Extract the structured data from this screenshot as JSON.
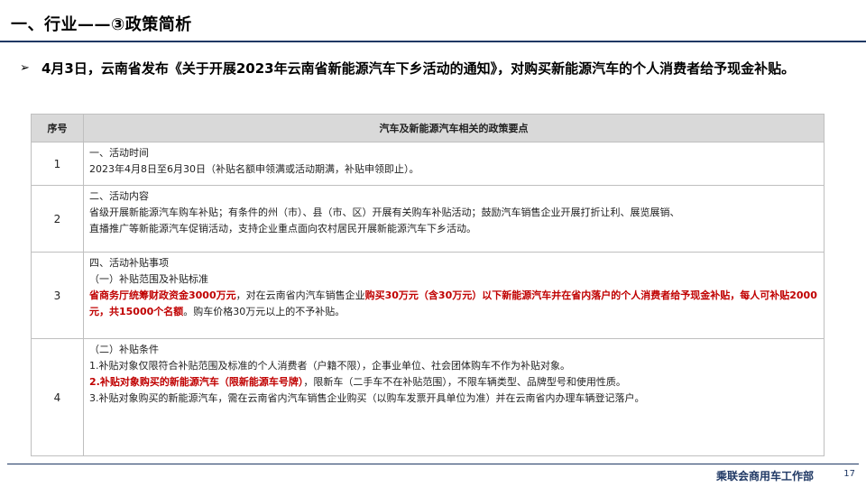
{
  "title": "一、行业——③政策简析",
  "bullet_arrow": "➢",
  "bullet_text": "4月3日，云南省发布《关于开展2023年云南省新能源汽车下乡活动的通知》，对购买新能源汽车的个人消费者给予现金补贴。",
  "table": {
    "header_seq": "序号",
    "header_content": "汽车及新能源汽车相关的政策要点",
    "rows": [
      {
        "seq": "1",
        "lines": [
          "一、活动时间",
          "2023年4月8日至6月30日（补贴名额申领满或活动期满，补贴申领即止）。"
        ]
      },
      {
        "seq": "2",
        "lines": [
          "二、活动内容",
          "省级开展新能源汽车购车补贴；有条件的州（市）、县（市、区）开展有关购车补贴活动；鼓励汽车销售企业开展打折让利、展览展销、",
          "直播推广等新能源汽车促销活动，支持企业重点面向农村居民开展新能源汽车下乡活动。"
        ]
      },
      {
        "seq": "3",
        "lines": [
          "四、活动补贴事项",
          "（一）补贴范围及补贴标准"
        ],
        "p_red1": "省商务厅统筹财政资金3000万元",
        "p_black1": "，对在云南省内汽车销售企业",
        "p_red2": "购买30万元（含30万元）以下新能源汽车并在省内落户的个人消费者给予现金补贴，每人可补贴2000元，共15000个名额",
        "p_black2": "。购车价格30万元以上的不予补贴。"
      },
      {
        "seq": "4",
        "line1": "（二）补贴条件",
        "line2": "1.补贴对象仅限符合补贴范围及标准的个人消费者（户籍不限），企事业单位、社会团体购车不作为补贴对象。",
        "line3_red": "2.补贴对象购买的新能源汽车（限新能源车号牌）",
        "line3_black": "，限新车（二手车不在补贴范围），不限车辆类型、品牌型号和使用性质。",
        "line4": "3.补贴对象购买的新能源汽车，需在云南省内汽车销售企业购买（以购车发票开具单位为准）并在云南省内办理车辆登记落户。"
      }
    ]
  },
  "footer": {
    "org": "乘联会商用车工作部",
    "page": "17"
  },
  "colors": {
    "accent_navy": "#1f3864",
    "highlight_red": "#c00000",
    "header_gray": "#d9d9d9"
  }
}
